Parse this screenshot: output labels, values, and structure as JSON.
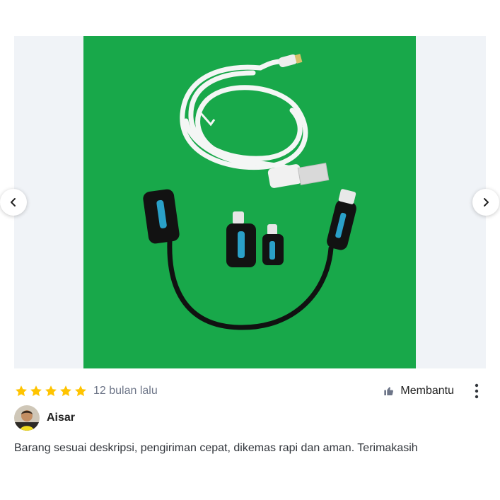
{
  "review": {
    "rating": 5,
    "rating_max": 5,
    "time_ago": "12 bulan lalu",
    "helpful_label": "Membantu",
    "user_name": "Aisar",
    "text": "Barang sesuai deskripsi, pengiriman cepat, dikemas rapi dan aman. Terimakasih"
  },
  "colors": {
    "star": "#ffc400",
    "photo_background": "#18a84a",
    "gallery_background": "#f0f3f7"
  },
  "icons": {
    "prev": "chevron-left-icon",
    "next": "chevron-right-icon",
    "helpful": "thumbs-up-icon",
    "more": "kebab-menu-icon"
  }
}
